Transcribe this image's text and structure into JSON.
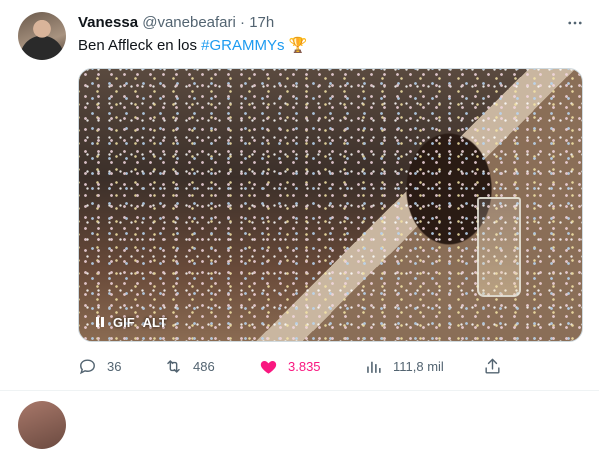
{
  "tweet": {
    "author_name": "Vanessa",
    "author_handle": "@vanebeafari",
    "separator": "·",
    "time": "17h",
    "text_plain": "Ben Affleck en los ",
    "hashtag": "#GRAMMYs",
    "emoji": "🏆",
    "more_icon": "more-horizontal-icon",
    "media": {
      "type": "gif",
      "gif_label": "GIF",
      "alt_label": "ALT",
      "pause_icon": "pause-icon"
    },
    "actions": {
      "replies": "36",
      "retweets": "486",
      "likes": "3.835",
      "views": "111,8 mil"
    }
  },
  "colors": {
    "accent": "#1d9bf0",
    "like": "#f91880",
    "secondary": "#536471"
  }
}
